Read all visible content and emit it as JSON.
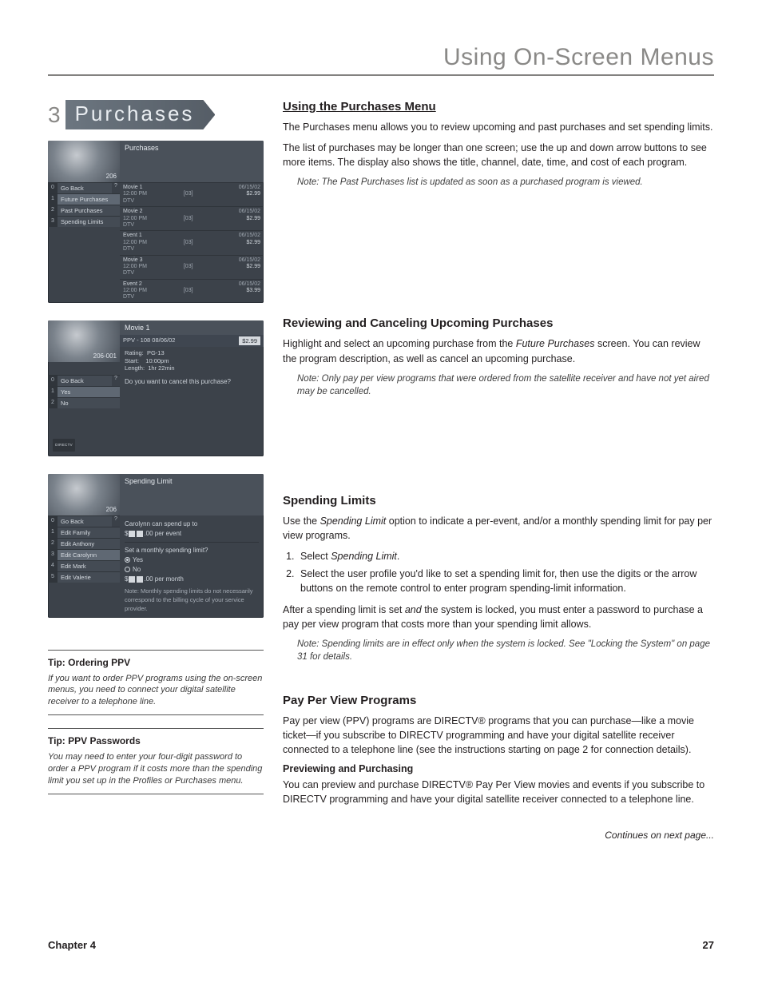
{
  "header": {
    "title": "Using On-Screen Menus"
  },
  "nav": {
    "number": "3",
    "label": "Purchases"
  },
  "screens": {
    "s1": {
      "panel_title": "Purchases",
      "channel": "206",
      "menu": [
        {
          "n": "0",
          "label": "Go Back",
          "q": "?"
        },
        {
          "n": "1",
          "label": "Future Purchases"
        },
        {
          "n": "2",
          "label": "Past Purchases"
        },
        {
          "n": "3",
          "label": "Spending Limits"
        }
      ],
      "rows": [
        {
          "title": "Movie 1",
          "time": "12:00 PM",
          "src": "DTV",
          "num": "[03]",
          "date": "06/15/02",
          "cost": "$2.99"
        },
        {
          "title": "Movie 2",
          "time": "12:00 PM",
          "src": "DTV",
          "num": "[03]",
          "date": "06/15/02",
          "cost": "$2.99"
        },
        {
          "title": "Event 1",
          "time": "12:00 PM",
          "src": "DTV",
          "num": "[03]",
          "date": "06/15/02",
          "cost": "$2.99"
        },
        {
          "title": "Movie 3",
          "time": "12:00 PM",
          "src": "DTV",
          "num": "[03]",
          "date": "06/15/02",
          "cost": "$2.99"
        },
        {
          "title": "Event 2",
          "time": "12:00 PM",
          "src": "DTV",
          "num": "[03]",
          "date": "06/15/02",
          "cost": "$3.99"
        }
      ]
    },
    "s2": {
      "panel_title": "Movie 1",
      "channel": "206-001",
      "info_line": "PPV - 108      08/06/02",
      "price": "$2.99",
      "rating_label": "Rating:",
      "rating": "PG-13",
      "start_label": "Start:",
      "start": "10:00pm",
      "length_label": "Length:",
      "length": "1hr 22min",
      "question": "Do you want to cancel this purchase?",
      "logo": "DIRECTV",
      "menu": [
        {
          "n": "0",
          "label": "Go Back",
          "q": "?"
        },
        {
          "n": "1",
          "label": "Yes"
        },
        {
          "n": "2",
          "label": "No"
        }
      ]
    },
    "s3": {
      "panel_title": "Spending Limit",
      "channel": "206",
      "line1a": "Carolynn can spend up to",
      "line1b_prefix": "$",
      "line1b_suffix": ".00 per event",
      "line2": "Set a monthly spending limit?",
      "yes": "Yes",
      "no": "No",
      "line3_prefix": "$",
      "line3_suffix": ".00 per month",
      "note": "Note: Monthly spending limits do not necessarily correspond to the billing cycle of your service provider.",
      "menu": [
        {
          "n": "0",
          "label": "Go Back",
          "q": "?"
        },
        {
          "n": "1",
          "label": "Edit Family"
        },
        {
          "n": "2",
          "label": "Edit Anthony"
        },
        {
          "n": "3",
          "label": "Edit Carolynn"
        },
        {
          "n": "4",
          "label": "Edit Mark"
        },
        {
          "n": "5",
          "label": "Edit Valerie"
        }
      ]
    }
  },
  "tips": {
    "t1": {
      "title": "Tip: Ordering PPV",
      "body": "If you want to order PPV programs using the on-screen menus, you need to connect your digital satellite receiver to a telephone line."
    },
    "t2": {
      "title": "Tip: PPV Passwords",
      "body": "You may need to enter your four-digit password to order a PPV program if it costs more than the spending limit you set up in the Profiles or Purchases menu."
    }
  },
  "sections": {
    "s1": {
      "h": "Using the Purchases Menu",
      "p1": "The Purchases menu allows you to review upcoming and past purchases and set spending limits.",
      "p2": "The list of purchases may be longer than one screen; use the up and down arrow buttons to see more items. The display also shows the title, channel, date, time, and cost of each program.",
      "note": "Note: The Past Purchases list is updated as soon as a purchased program is viewed."
    },
    "s2": {
      "h": "Reviewing and Canceling Upcoming Purchases",
      "p1a": "Highlight and select an upcoming purchase from the ",
      "p1_em": "Future Purchases",
      "p1b": " screen. You can review the program description, as well as cancel an upcoming purchase.",
      "note": "Note: Only pay per view programs that were ordered from the satellite receiver and have not yet aired may be cancelled."
    },
    "s3": {
      "h": "Spending Limits",
      "p1a": "Use the ",
      "p1_em": "Spending Limit",
      "p1b": " option to indicate a per-event, and/or a monthly spending limit for pay per view programs.",
      "li1a": "Select ",
      "li1_em": "Spending Limit",
      "li1b": ".",
      "li2": "Select the user profile you'd like to set a spending limit for, then use the digits or the arrow buttons on the remote control to enter program spending-limit information.",
      "p2a": "After a spending limit is set ",
      "p2_em": "and",
      "p2b": " the system is locked, you must enter a password to purchase a pay per view program that costs more than your spending limit allows.",
      "note": "Note: Spending limits are in effect only when the system is locked. See \"Locking the System\" on page 31 for details."
    },
    "s4": {
      "h": "Pay Per View Programs",
      "p1": "Pay per view (PPV) programs are DIRECTV® programs that you can purchase—like a movie ticket—if you subscribe to DIRECTV programming and have your digital satellite receiver connected to a telephone line (see the instructions  starting on page 2 for connection details).",
      "sub": "Previewing and Purchasing",
      "p2": "You can preview and purchase DIRECTV® Pay Per View movies and events if you subscribe to DIRECTV programming and have your digital satellite receiver connected to a telephone line."
    },
    "continues": "Continues on next page..."
  },
  "footer": {
    "left": "Chapter 4",
    "right": "27"
  }
}
